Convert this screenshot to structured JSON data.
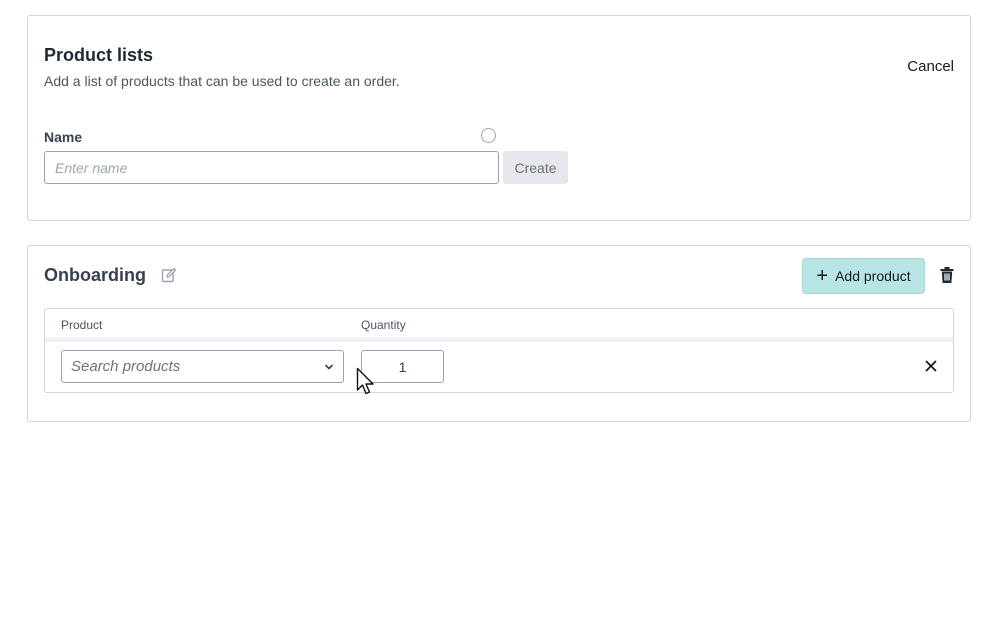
{
  "create_panel": {
    "title": "Product lists",
    "subtitle": "Add a list of products that can be used to create an order.",
    "cancel_label": "Cancel",
    "name_label": "Name",
    "name_placeholder": "Enter name",
    "name_value": "",
    "create_label": "Create",
    "loading_icon": "loading-spinner-icon"
  },
  "list_panel": {
    "title": "Onboarding",
    "edit_icon": "edit-icon",
    "add_product_label": "Add product",
    "add_icon": "plus-icon",
    "delete_icon": "trash-icon",
    "table": {
      "columns": [
        "Product",
        "Quantity"
      ],
      "rows": [
        {
          "product_placeholder": "Search products",
          "quantity": "1",
          "remove_icon": "close-icon"
        }
      ]
    }
  },
  "colors": {
    "accent_button": "#b9e4e4",
    "border": "#d1d5db",
    "muted_button": "#e5e7eb"
  }
}
